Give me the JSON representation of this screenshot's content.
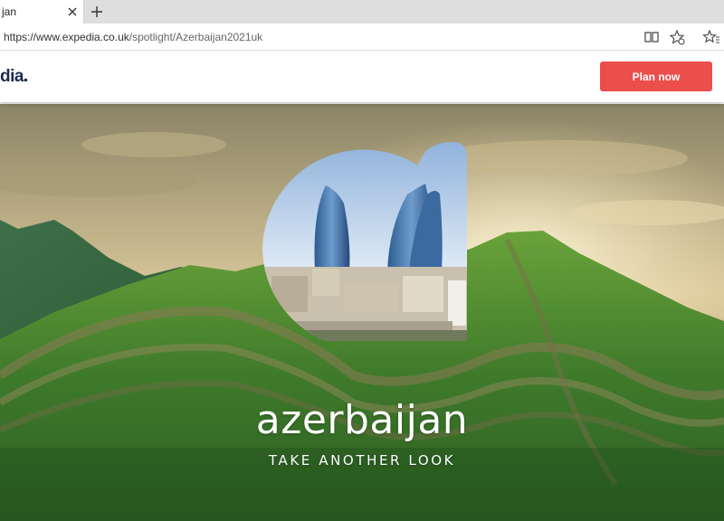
{
  "browser": {
    "tab": {
      "title": "jan",
      "close_icon": "close-icon"
    },
    "new_tab_icon": "plus-icon",
    "address": {
      "url_host": "https://www.expedia.co.uk",
      "url_path": "/spotlight/Azerbaijan2021uk"
    },
    "toolbar_icons": [
      "reading-view-icon",
      "favorite-add-icon",
      "favorites-icon"
    ]
  },
  "site": {
    "logo_text": "dia",
    "plan_button": "Plan now",
    "colors": {
      "accent": "#ec4e4b",
      "logo": "#1b2a4d"
    }
  },
  "hero": {
    "title": "azerbaijan",
    "subtitle": "TAKE ANOTHER LOOK"
  }
}
